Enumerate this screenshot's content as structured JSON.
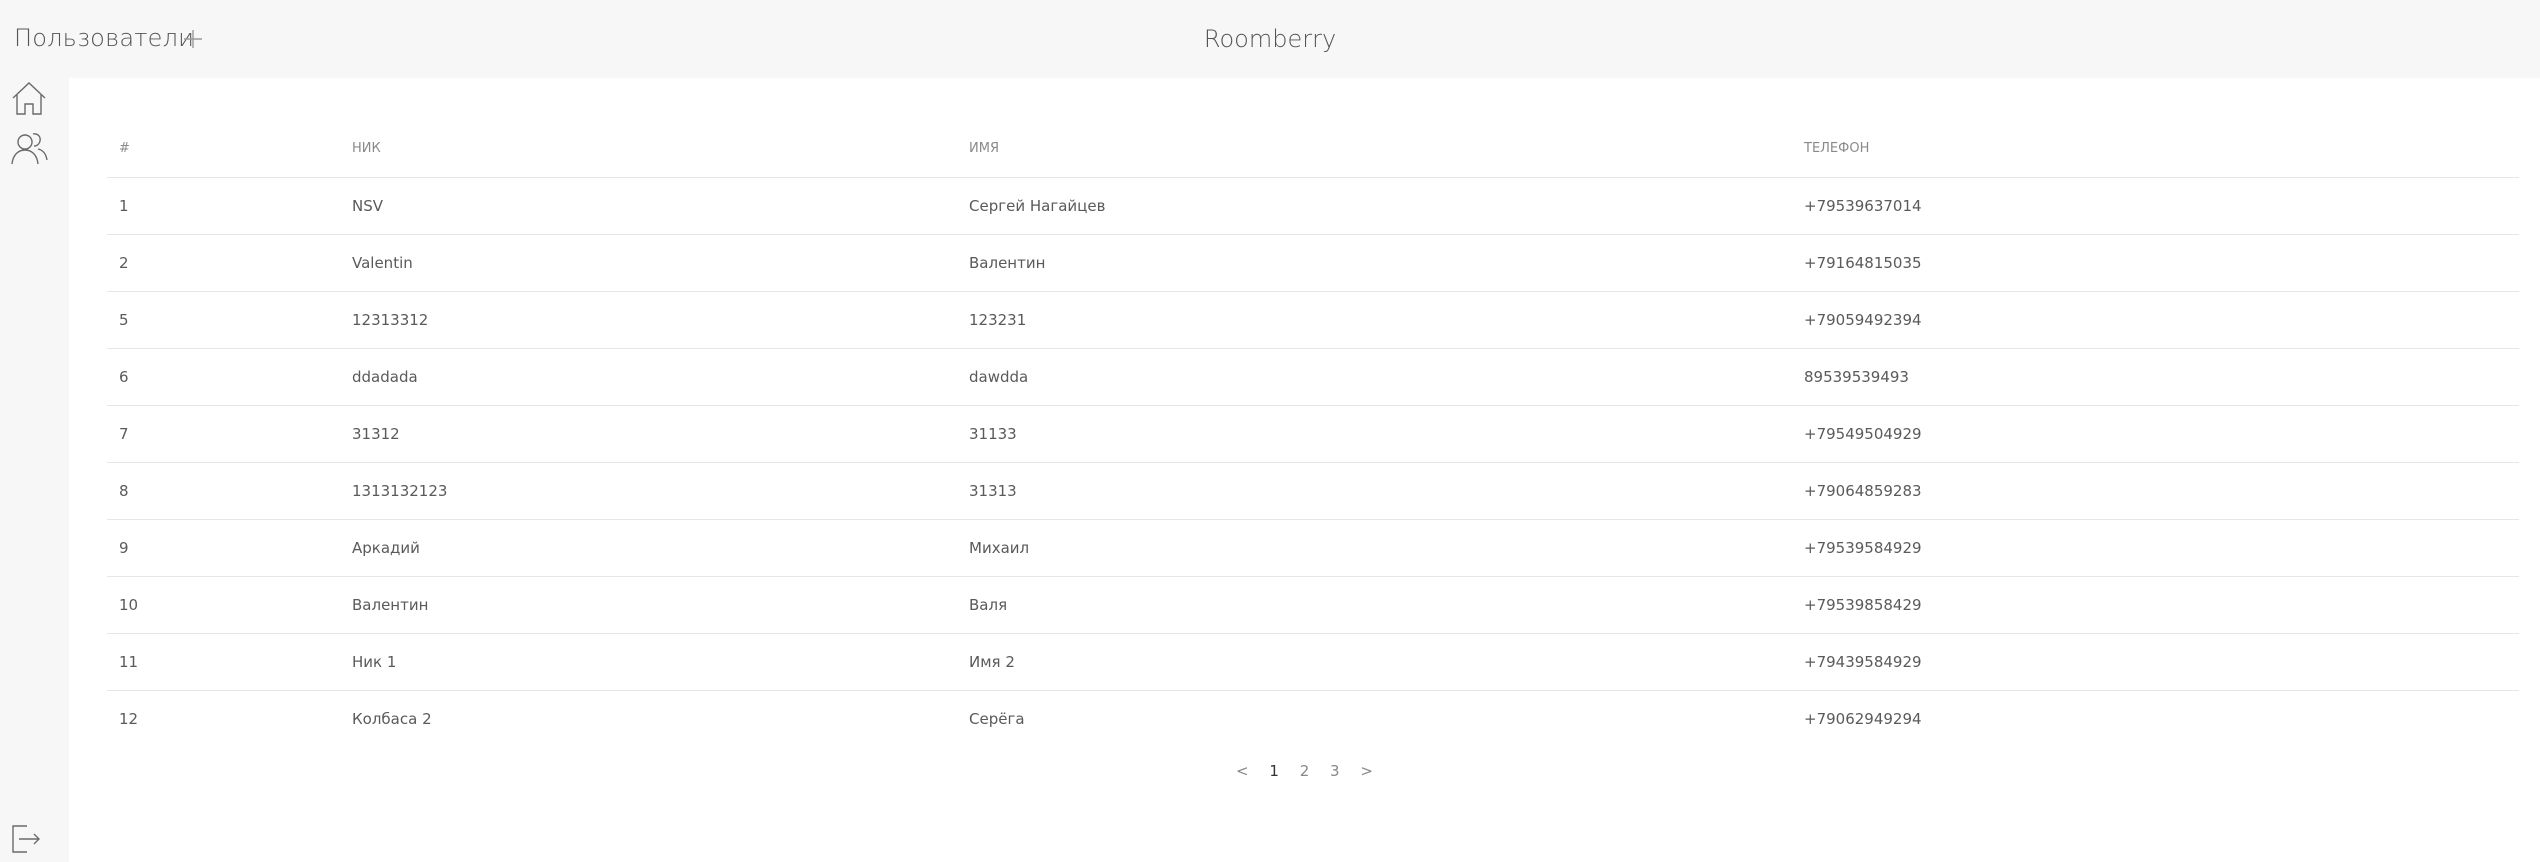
{
  "header": {
    "page_title": "Пользователи",
    "app_title": "Roomberry"
  },
  "sidebar": {
    "items": [
      {
        "icon": "home-icon"
      },
      {
        "icon": "users-icon"
      },
      {
        "icon": "logout-icon"
      }
    ]
  },
  "table": {
    "columns": [
      "#",
      "НИК",
      "ИМЯ",
      "ТЕЛЕФОН"
    ],
    "rows": [
      {
        "id": "1",
        "nick": "NSV",
        "name": "Сергей Нагайцев",
        "phone": "+79539637014"
      },
      {
        "id": "2",
        "nick": "Valentin",
        "name": "Валентин",
        "phone": "+79164815035"
      },
      {
        "id": "5",
        "nick": "12313312",
        "name": "123231",
        "phone": "+79059492394"
      },
      {
        "id": "6",
        "nick": "ddadada",
        "name": "dawdda",
        "phone": "89539539493"
      },
      {
        "id": "7",
        "nick": "31312",
        "name": "31133",
        "phone": "+79549504929"
      },
      {
        "id": "8",
        "nick": "1313132123",
        "name": "31313",
        "phone": "+79064859283"
      },
      {
        "id": "9",
        "nick": "Аркадий",
        "name": "Михаил",
        "phone": "+79539584929"
      },
      {
        "id": "10",
        "nick": "Валентин",
        "name": "Валя",
        "phone": "+79539858429"
      },
      {
        "id": "11",
        "nick": "Ник 1",
        "name": "Имя 2",
        "phone": "+79439584929"
      },
      {
        "id": "12",
        "nick": "Колбаса 2",
        "name": "Серёга",
        "phone": "+79062949294"
      }
    ]
  },
  "pagination": {
    "prev": "<",
    "pages": [
      "1",
      "2",
      "3"
    ],
    "current": "1",
    "next": ">"
  },
  "colors": {
    "background": "#f7f7f7",
    "content": "#ffffff",
    "text": "#5a5a5a",
    "divider": "#e6e6e6"
  }
}
